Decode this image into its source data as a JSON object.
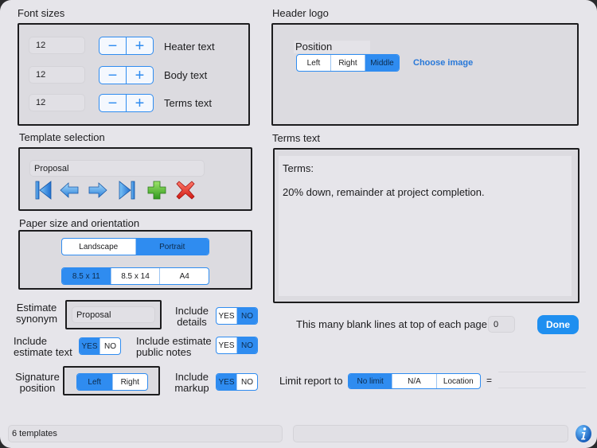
{
  "font_sizes": {
    "title": "Font sizes",
    "rows": [
      {
        "value": "12",
        "label": "Heater text"
      },
      {
        "value": "12",
        "label": "Body text"
      },
      {
        "value": "12",
        "label": "Terms text"
      }
    ],
    "minus": "−",
    "plus": "+"
  },
  "header_logo": {
    "title": "Header logo",
    "position_label": "Position",
    "options": [
      "Left",
      "Right",
      "Middle"
    ],
    "selected": "Middle",
    "choose_image": "Choose image"
  },
  "template_selection": {
    "title": "Template selection",
    "name": "Proposal",
    "icons": [
      "first-icon",
      "previous-icon",
      "next-icon",
      "last-icon",
      "add-icon",
      "delete-icon"
    ]
  },
  "paper": {
    "title": "Paper size and orientation",
    "orientation": [
      "Landscape",
      "Portrait"
    ],
    "orientation_selected": "Portrait",
    "sizes": [
      "8.5 x 11",
      "8.5 x 14",
      "A4"
    ],
    "size_selected": "8.5 x 11"
  },
  "terms": {
    "title": "Terms text",
    "line1": "Terms:",
    "line2": "20% down, remainder at project completion."
  },
  "estimate_synonym": {
    "label_line1": "Estimate",
    "label_line2": "synonym",
    "value": "Proposal"
  },
  "include_details": {
    "label_line1": "Include",
    "label_line2": "details",
    "yes": "YES",
    "no": "NO",
    "selected": "NO"
  },
  "include_estimate_text": {
    "label_line1": "Include",
    "label_line2": "estimate text",
    "yes": "YES",
    "no": "NO",
    "selected": "YES"
  },
  "include_public_notes": {
    "label_line1": "Include estimate",
    "label_line2": "public notes",
    "yes": "YES",
    "no": "NO",
    "selected": "NO"
  },
  "signature_position": {
    "label_line1": "Signature",
    "label_line2": "position",
    "options": [
      "Left",
      "Right"
    ],
    "selected": "Left"
  },
  "include_markup": {
    "label_line1": "Include",
    "label_line2": "markup",
    "yes": "YES",
    "no": "NO",
    "selected": "YES"
  },
  "blank_lines": {
    "label": "This many blank lines at top of each page",
    "value": "0"
  },
  "done_label": "Done",
  "limit_report": {
    "label": "Limit report to",
    "options": [
      "No limit",
      "N/A",
      "Location"
    ],
    "selected": "No limit",
    "equals": "=",
    "value": ""
  },
  "status": {
    "left": "6 templates",
    "right": "",
    "info_icon": "info-icon"
  },
  "colors": {
    "accent": "#2f8cf0",
    "done_button": "#1f8ff0",
    "link": "#2878d8",
    "background": "#e6e5ea",
    "panel": "#dcdbe0"
  }
}
